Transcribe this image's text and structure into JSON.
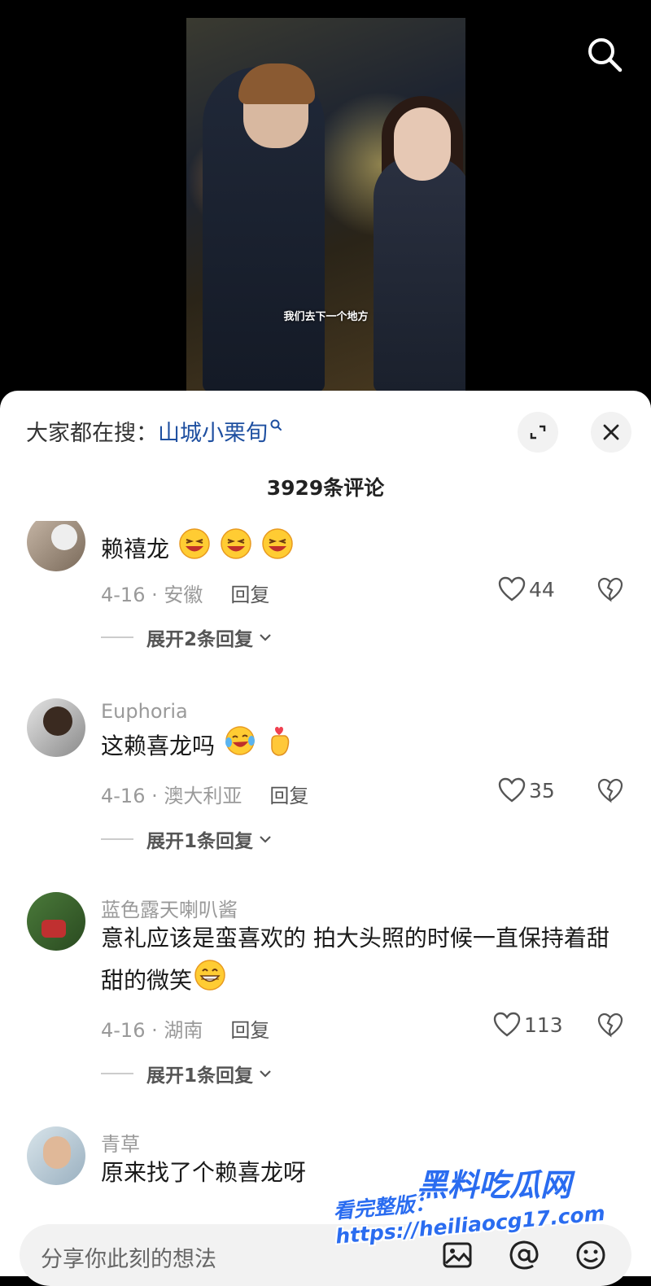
{
  "video": {
    "caption": "我们去下一个地方"
  },
  "panel": {
    "trending_prefix": "大家都在搜：",
    "trending_term": "山城小栗旬",
    "comment_count_title": "3929条评论"
  },
  "comments": [
    {
      "username": "",
      "text": "赖禧龙",
      "emojis": [
        "laughing-emoji",
        "laughing-emoji",
        "laughing-emoji"
      ],
      "date_location": "4-16 · 安徽",
      "reply_label": "回复",
      "likes": "44",
      "expand_label": "展开2条回复"
    },
    {
      "username": "Euphoria",
      "text": "这赖喜龙吗",
      "emojis": [
        "crying-laughing-emoji",
        "finger-heart-emoji"
      ],
      "date_location": "4-16 · 澳大利亚",
      "reply_label": "回复",
      "likes": "35",
      "expand_label": "展开1条回复"
    },
    {
      "username": "蓝色露天喇叭酱",
      "text": "意礼应该是蛮喜欢的 拍大头照的时候一直保持着甜甜的微笑",
      "emojis": [
        "grinning-emoji"
      ],
      "date_location": "4-16 · 湖南",
      "reply_label": "回复",
      "likes": "113",
      "expand_label": "展开1条回复"
    },
    {
      "username": "青草",
      "text": "原来找了个赖喜龙呀",
      "emojis": [],
      "date_location": "",
      "reply_label": "",
      "likes": "",
      "expand_label": ""
    }
  ],
  "input": {
    "placeholder": "分享你此刻的想法"
  },
  "watermark": {
    "title": "黑料吃瓜网",
    "url": "看完整版：https://heiliaocg17.com"
  },
  "colors": {
    "accent_link": "#1e4fa0",
    "watermark": "#2a6cf0"
  }
}
